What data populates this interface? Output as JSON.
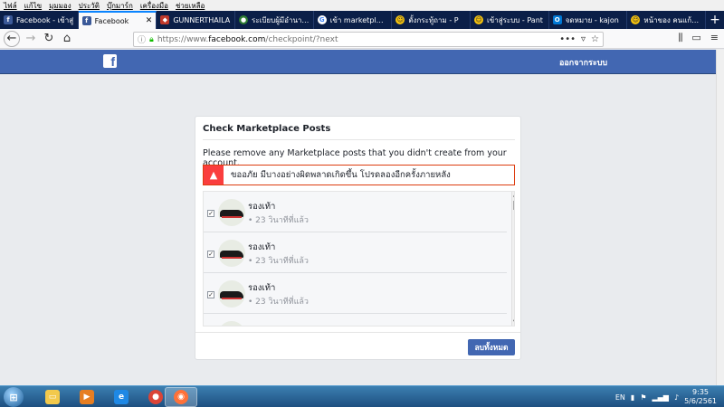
{
  "menubar": [
    "ไฟล์",
    "แก้ไข",
    "มุมมอง",
    "ประวัติ",
    "บุ๊กมาร์ก",
    "เครื่องมือ",
    "ช่วยเหลือ"
  ],
  "tabs": [
    {
      "label": "Facebook - เข้าสู่",
      "icon": "facebook-icon"
    },
    {
      "label": "Facebook",
      "icon": "facebook-icon",
      "active": true
    },
    {
      "label": "GUNNERTHAILA",
      "icon": "shield-icon"
    },
    {
      "label": "ระเบียบผู้มีอำนาจส่ง",
      "icon": "globe-icon"
    },
    {
      "label": "เข้า marketplace",
      "icon": "google-icon"
    },
    {
      "label": "ตั้งกระทู้ถาม - P",
      "icon": "smiley-icon"
    },
    {
      "label": "เข้าสู่ระบบ - Pant",
      "icon": "smiley-icon"
    },
    {
      "label": "จดหมาย - kajon",
      "icon": "outlook-icon"
    },
    {
      "label": "หน้าของ คนแก้ปัญ",
      "icon": "smiley-icon"
    }
  ],
  "navbar": {
    "url_scheme": "https://www.",
    "url_host": "facebook.com",
    "url_path": "/checkpoint/?next"
  },
  "fbheader": {
    "logo": "f",
    "logout_label": "ออกจากระบบ"
  },
  "dialog": {
    "title": "Check Marketplace Posts",
    "instruction": "Please remove any Marketplace posts that you didn't create from your account.",
    "error": "ขออภัย มีบางอย่างผิดพลาดเกิดขึ้น โปรดลองอีกครั้งภายหลัง",
    "items": [
      {
        "title": "รองเท้า",
        "time": "• 23 วินาทีที่แล้ว",
        "checked": true
      },
      {
        "title": "รองเท้า",
        "time": "• 23 วินาทีที่แล้ว",
        "checked": true
      },
      {
        "title": "รองเท้า",
        "time": "• 23 วินาทีที่แล้ว",
        "checked": true
      }
    ],
    "delete_all_label": "ลบทั้งหมด"
  },
  "taskbar": {
    "language": "EN",
    "time": "9:35",
    "date": "5/6/2561"
  },
  "colors": {
    "facebook_blue": "#4267b2",
    "error_red": "#fa3e3e",
    "tab_strip": "#0b1f48"
  }
}
